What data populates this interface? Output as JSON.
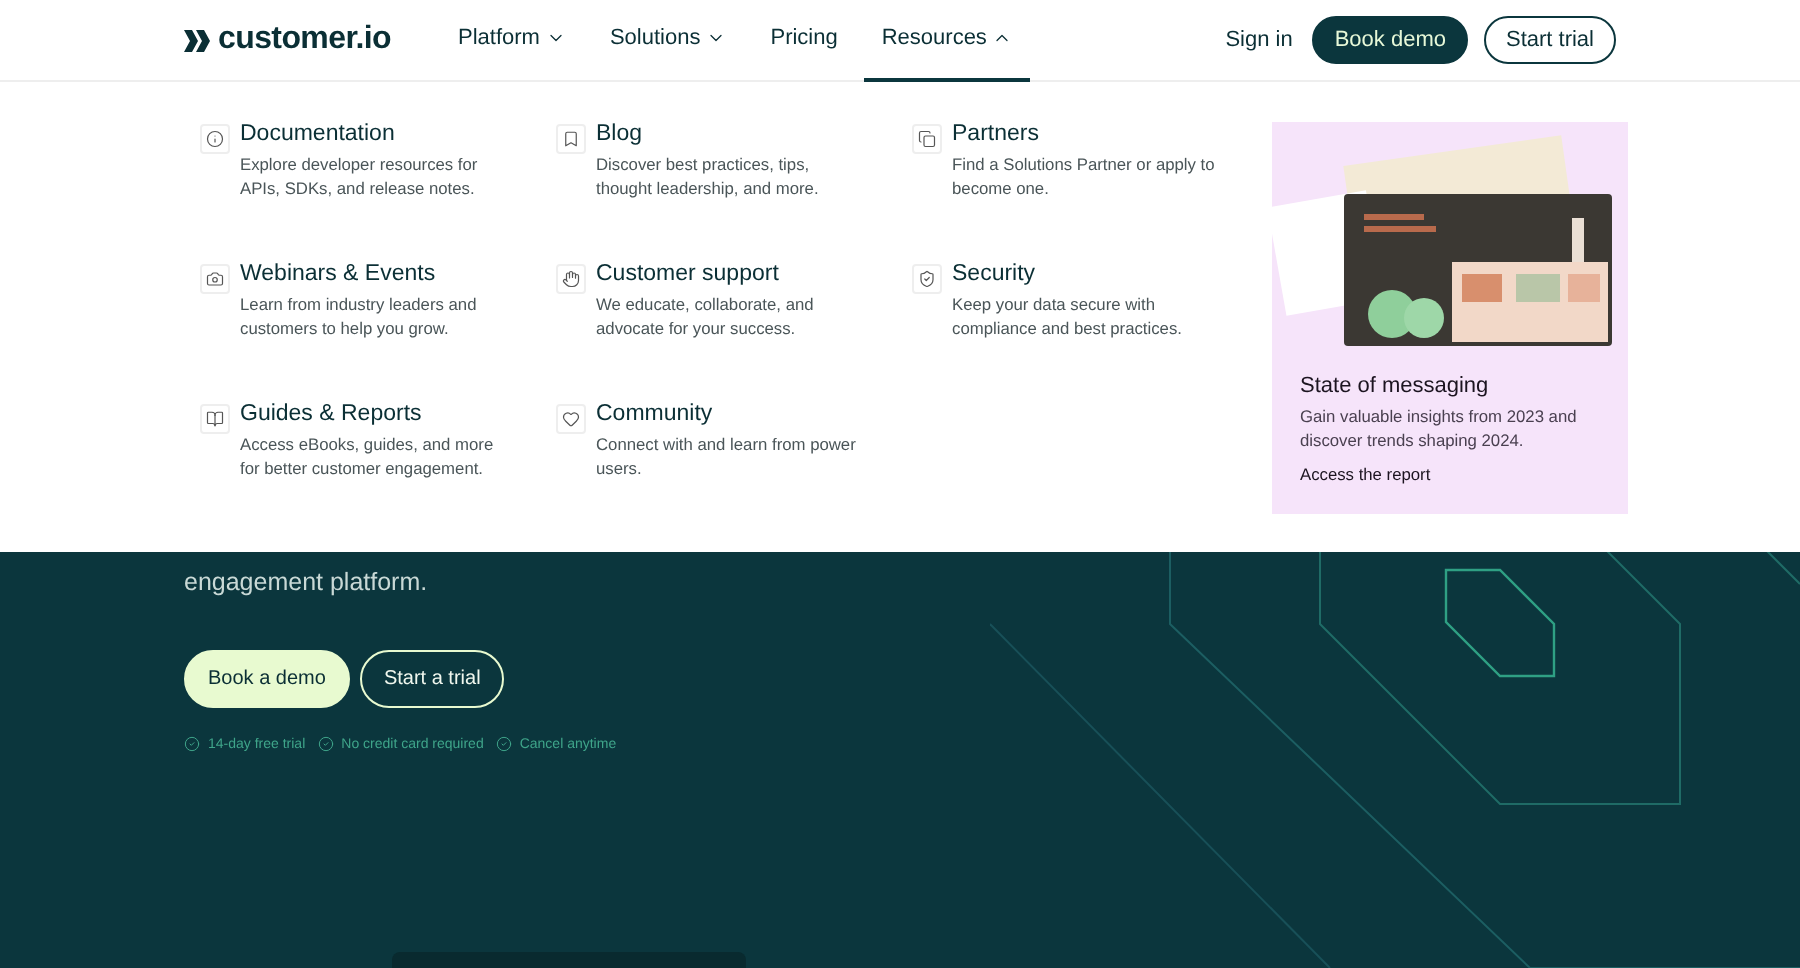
{
  "header": {
    "logo": "customer.io",
    "nav": [
      {
        "label": "Platform",
        "kind": "dropdown",
        "expanded": false,
        "selected": false
      },
      {
        "label": "Solutions",
        "kind": "dropdown",
        "expanded": false,
        "selected": false
      },
      {
        "label": "Pricing",
        "kind": "link",
        "selected": false
      },
      {
        "label": "Resources",
        "kind": "dropdown",
        "expanded": true,
        "selected": true
      }
    ],
    "sign_in": "Sign in",
    "book_demo": "Book demo",
    "start_trial": "Start trial"
  },
  "menu": {
    "items": [
      {
        "title": "Documentation",
        "description": "Explore developer resources for APIs, SDKs, and release notes."
      },
      {
        "title": "Blog",
        "description": "Discover best practices, tips, thought leadership, and more."
      },
      {
        "title": "Partners",
        "description": "Find a Solutions Partner or apply to become one."
      },
      {
        "title": "Webinars & Events",
        "description": "Learn from industry leaders and customers to help you grow."
      },
      {
        "title": "Customer support",
        "description": "We educate, collaborate, and advocate for your success."
      },
      {
        "title": "Security",
        "description": "Keep your data secure with compliance and best practices."
      },
      {
        "title": "Guides & Reports",
        "description": "Access eBooks, guides, and more for better customer engagement."
      },
      {
        "title": "Community",
        "description": "Connect with and learn from power users."
      }
    ],
    "feature": {
      "kind": "picture",
      "title": "State of messaging",
      "description": "Gain valuable insights from 2023 and discover trends shaping 2024.",
      "link": "Access the report"
    }
  },
  "hero": {
    "text_lines": [
      "engagement platform."
    ],
    "book_demo": "Book a demo",
    "start_trial": "Start a trial",
    "perks": [
      "14-day free trial",
      "No credit card required",
      "Cancel anytime"
    ]
  }
}
